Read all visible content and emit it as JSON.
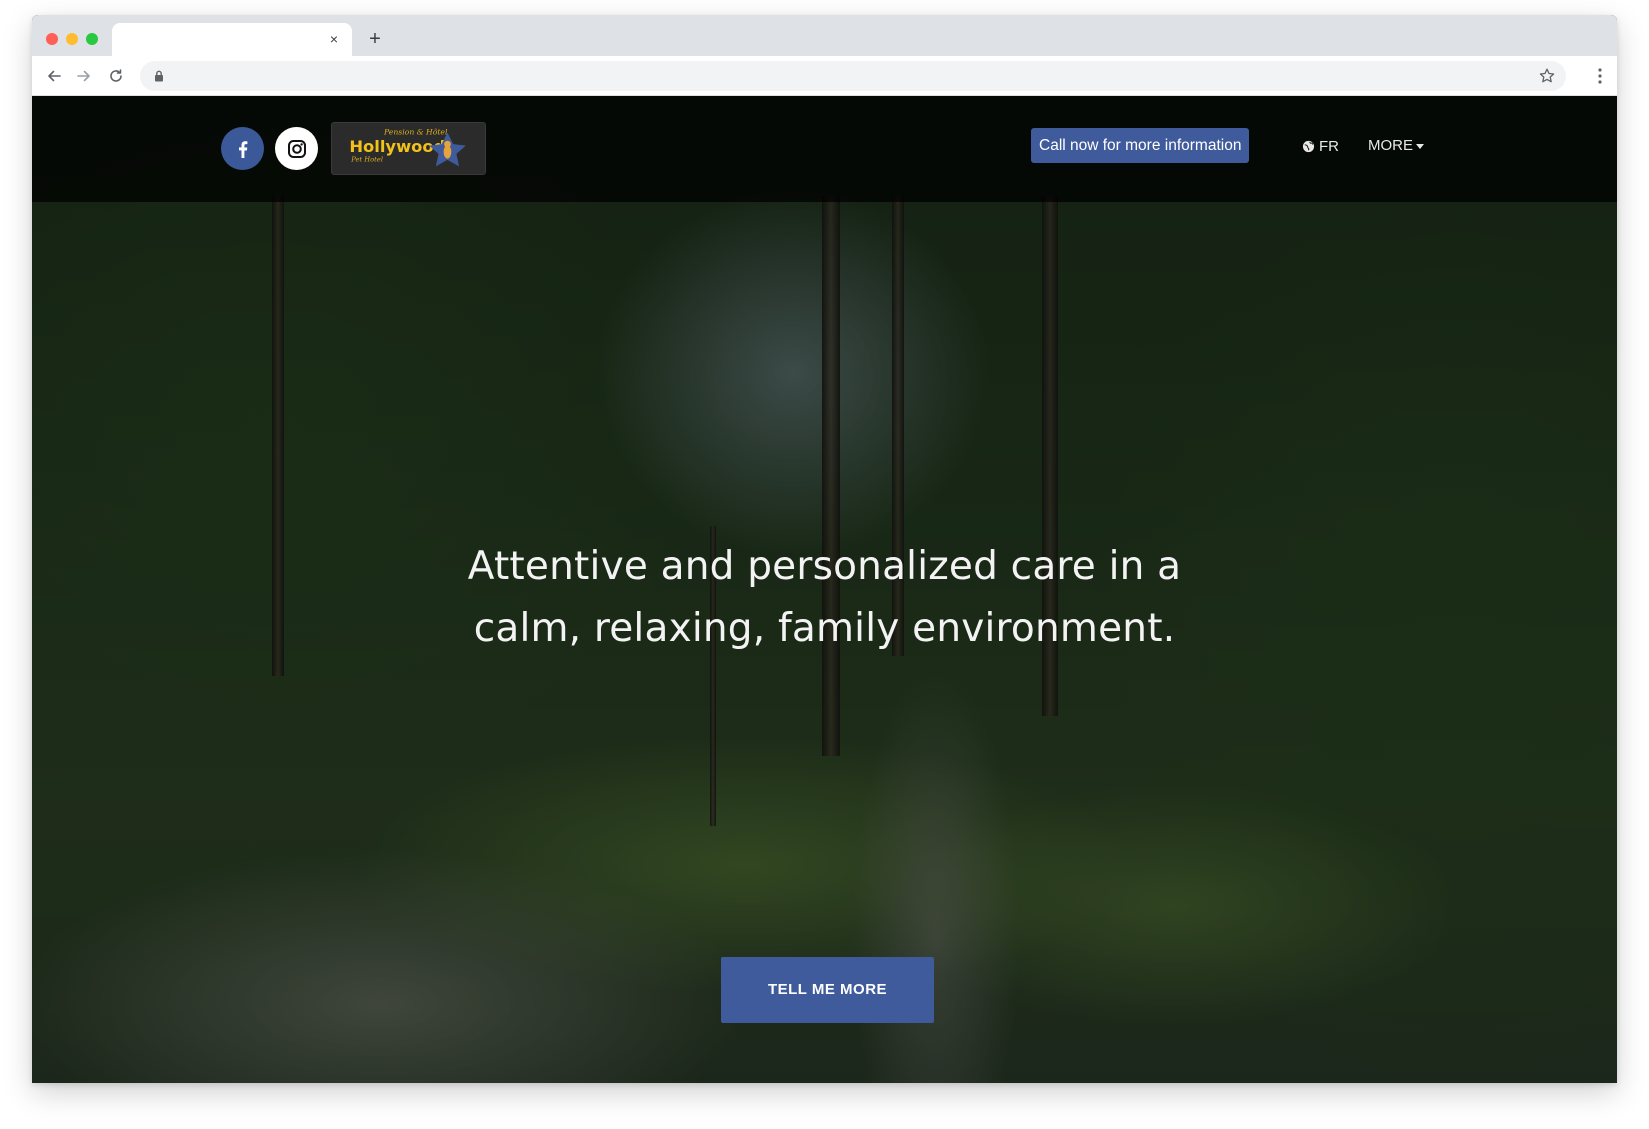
{
  "browser": {
    "tab": {
      "close_glyph": "×"
    },
    "new_tab_glyph": "+",
    "icons": [
      "back-arrow-icon",
      "forward-arrow-icon",
      "reload-icon",
      "lock-icon",
      "star-icon",
      "menu-dots-icon",
      "tab-close-icon",
      "new-tab-icon"
    ]
  },
  "header": {
    "social": {
      "facebook_icon": "facebook-icon",
      "instagram_icon": "instagram-icon"
    },
    "logo": {
      "tagline_top": "Pension & Hôtel",
      "brand": "Hollywood",
      "tagline_bottom": "Pet Hotel"
    },
    "call_button_label": "Call now for more information",
    "language_label": "FR",
    "more_label": "MORE"
  },
  "hero": {
    "headline_line1": "Attentive and personalized care in a",
    "headline_line2": "calm, relaxing, family environment.",
    "cta_label": "TELL ME MORE"
  },
  "colors": {
    "accent": "#3f5b9b",
    "facebook": "#3b5998",
    "header_bg": "#000000",
    "logo_gold": "#f2c21b"
  }
}
